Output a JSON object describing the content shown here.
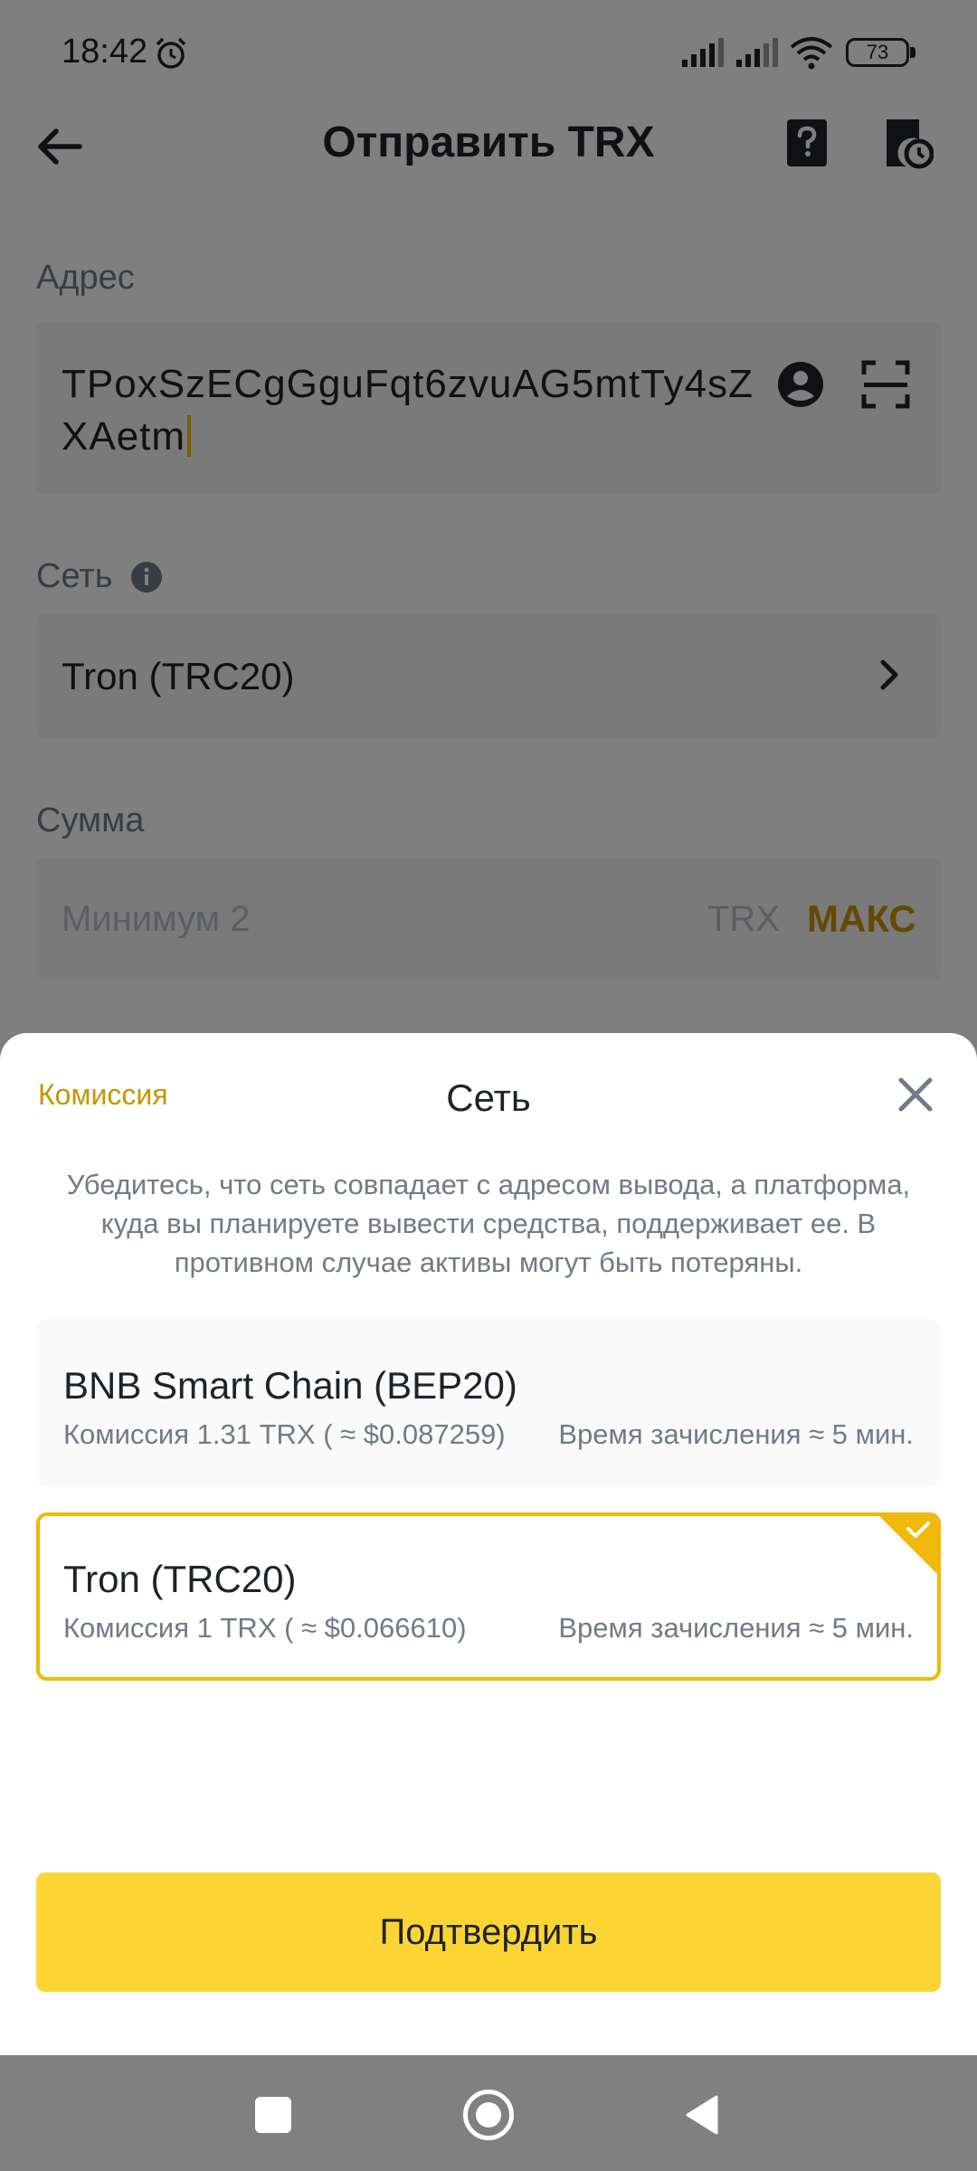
{
  "status_bar": {
    "time": "18:42",
    "battery": "73"
  },
  "header": {
    "title": "Отправить TRX"
  },
  "form": {
    "address_label": "Адрес",
    "address_value": "TPoxSzECgGguFqt6zvuAG5mtTy4sZXAetm",
    "network_label": "Сеть",
    "network_value": "Tron (TRC20)",
    "amount_label": "Сумма",
    "amount_placeholder": "Минимум 2",
    "amount_unit": "TRX",
    "max_label": "МАКС"
  },
  "sheet": {
    "link": "Комиссия",
    "title": "Сеть",
    "description": "Убедитесь, что сеть совпадает с адресом вывода, а платформа, куда вы планируете вывести средства, поддерживает ее. В противном случае активы могут быть потеряны.",
    "options": [
      {
        "name": "BNB Smart Chain (BEP20)",
        "fee": "Комиссия  1.31 TRX ( ≈ $0.087259)",
        "time": "Время зачисления ≈ 5 мин.",
        "selected": false
      },
      {
        "name": "Tron (TRC20)",
        "fee": "Комиссия  1 TRX ( ≈ $0.066610)",
        "time": "Время зачисления ≈ 5 мин.",
        "selected": true
      }
    ],
    "confirm_label": "Подтвердить"
  },
  "colors": {
    "accent": "#fcd535",
    "accent_dark": "#f0b90b",
    "link": "#c99400"
  },
  "icons": [
    "alarm-icon",
    "signal-icon",
    "wifi-icon",
    "back-icon",
    "help-icon",
    "history-icon",
    "contact-icon",
    "scan-icon",
    "info-icon",
    "chevron-right-icon",
    "close-icon",
    "check-icon"
  ]
}
